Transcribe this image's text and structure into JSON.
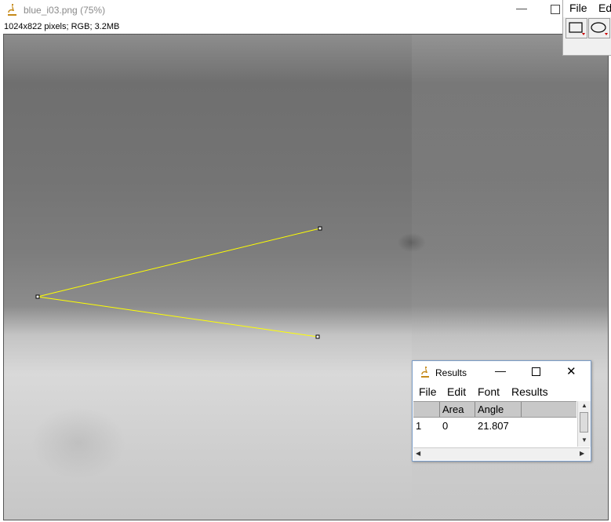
{
  "image_window": {
    "title": "blue_i03.png",
    "zoom": "(75%)",
    "info": "1024x822 pixels; RGB; 3.2MB",
    "controls": {
      "minimize": "—"
    }
  },
  "toolbar": {
    "menus": [
      "File",
      "Ed"
    ]
  },
  "angle_tool": {
    "color": "#ffff00",
    "handle_fill": "#ffffff"
  },
  "results": {
    "title": "Results",
    "controls": {
      "minimize": "—",
      "close": "✕"
    },
    "menus": [
      "File",
      "Edit",
      "Font",
      "Results"
    ],
    "columns": [
      "",
      "Area",
      "Angle"
    ],
    "rows": [
      {
        "index": "1",
        "area": "0",
        "angle": "21.807"
      }
    ]
  }
}
